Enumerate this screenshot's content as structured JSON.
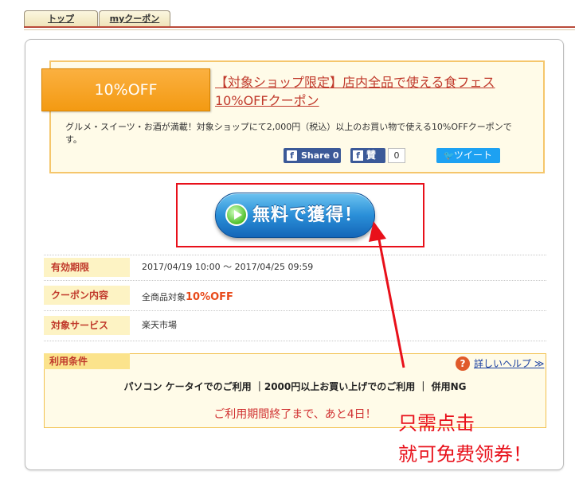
{
  "tabs": [
    {
      "label": "トップ"
    },
    {
      "label": "myクーポン"
    }
  ],
  "coupon": {
    "discount_badge": "10%OFF",
    "title_line1": "【対象ショップ限定】店内全品で使える食フェス",
    "title_line2": "10%OFFクーポン",
    "description": "グルメ・スイーツ・お酒が満載！対象ショップにて2,000円（税込）以上のお買い物で使える10%OFFクーポンです。"
  },
  "share": {
    "fb_icon": "f",
    "fb_share_label": "Share 0",
    "like_label": "賛",
    "like_count": "0",
    "tweet_label": "ツイート"
  },
  "get_button": {
    "label": "無料で獲得！"
  },
  "details": [
    {
      "label": "有効期限",
      "value": "2017/04/19 10:00 ～ 2017/04/25 09:59"
    },
    {
      "label": "クーポン内容",
      "value_prefix": "全商品対象",
      "value_highlight": "10%OFF"
    },
    {
      "label": "対象サービス",
      "value": "楽天市場"
    }
  ],
  "conditions": {
    "label": "利用条件",
    "help_icon": "?",
    "help_link": "詳しいヘルプ ≫",
    "text": "パソコン ケータイでのご利用 ｜2000円以上お買い上げでのご利用 ｜ 併用NG",
    "period": "ご利用期間終了まで、あと4日！"
  },
  "annotation": {
    "line1": "只需点击",
    "line2": "就可免费领券！"
  },
  "colors": {
    "accent_red": "#e8101a",
    "badge_orange": "#f39a12",
    "button_blue": "#2a8fd8",
    "facebook_blue": "#3b5998",
    "twitter_blue": "#1da1f2"
  }
}
